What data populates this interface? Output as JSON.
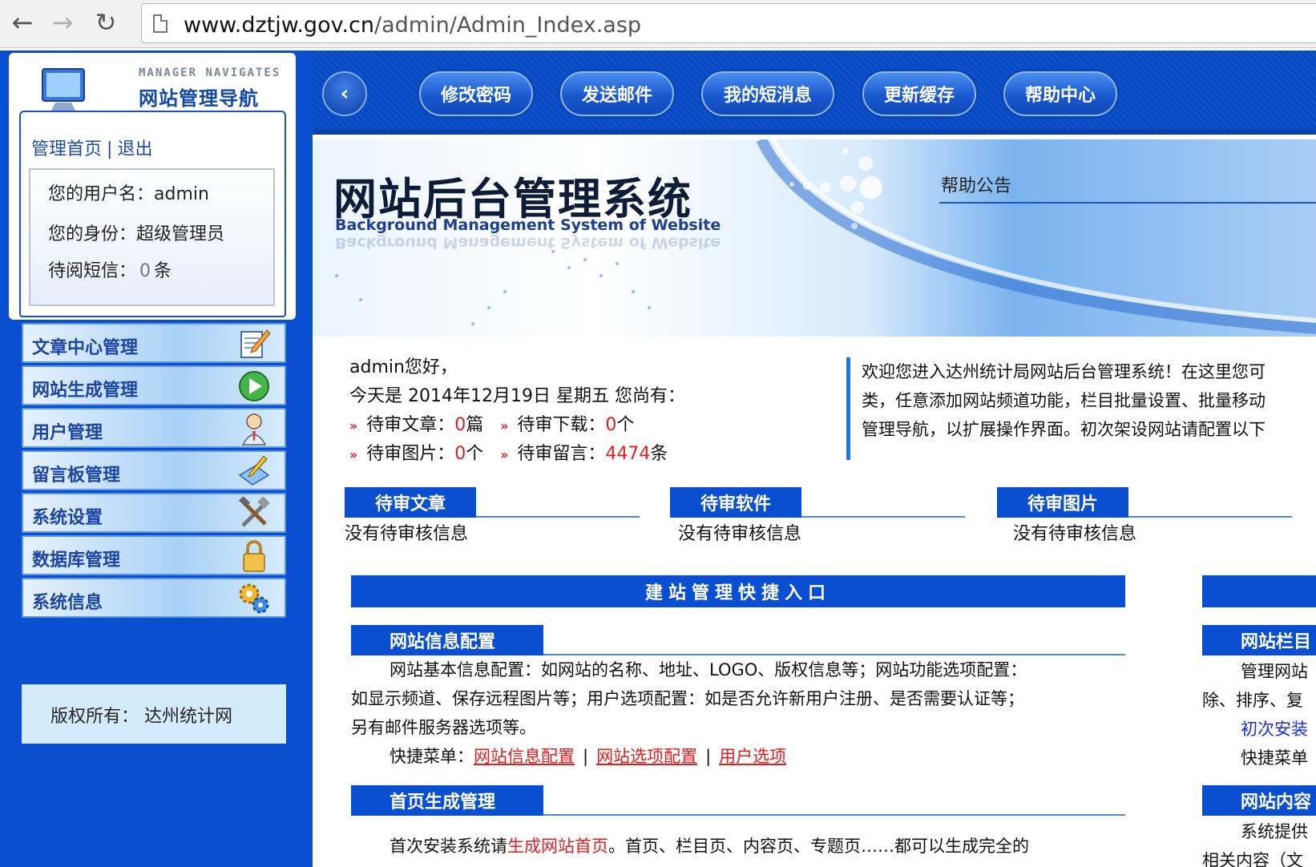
{
  "browser": {
    "url_host": "www.dztjw.gov.cn",
    "url_path": "/admin/Admin_Index.asp",
    "back_icon": "arrow-left-icon",
    "forward_icon": "arrow-right-icon",
    "reload_icon": "reload-icon"
  },
  "sidebar": {
    "logo_subtitle": "MANAGER NAVIGATES",
    "logo_title": "网站管理导航",
    "home_link": "管理首页",
    "link_separator": "|",
    "logout_link": "退出",
    "username_label": "您的用户名：",
    "username": "admin",
    "role_label": "您的身份：",
    "role": "超级管理员",
    "unread_label": "待阅短信：",
    "unread_count": "0",
    "unread_unit": "条",
    "menu": [
      {
        "label": "文章中心管理",
        "icon": "edit-document-icon"
      },
      {
        "label": "网站生成管理",
        "icon": "play-circle-icon"
      },
      {
        "label": "用户管理",
        "icon": "user-icon"
      },
      {
        "label": "留言板管理",
        "icon": "message-pencil-icon"
      },
      {
        "label": "系统设置",
        "icon": "tools-icon"
      },
      {
        "label": "数据库管理",
        "icon": "lock-icon"
      },
      {
        "label": "系统信息",
        "icon": "gears-icon"
      }
    ],
    "copyright": "版权所有： 达州统计网"
  },
  "toolbar": {
    "collapse_glyph": "‹",
    "buttons": [
      "修改密码",
      "发送邮件",
      "我的短消息",
      "更新缓存",
      "帮助中心"
    ]
  },
  "banner": {
    "title": "网站后台管理系统",
    "subtitle": "Background Management System of Website",
    "help_title": "帮助公告"
  },
  "greeting": {
    "line1": "admin您好，",
    "line2": "今天是 2014年12月19日 星期五 您尚有：",
    "arrow": "››",
    "pending_articles_label": "待审文章：",
    "pending_articles": "0",
    "pending_articles_unit": "篇",
    "pending_downloads_label": "待审下载：",
    "pending_downloads": "0",
    "pending_downloads_unit": "个",
    "pending_images_label": "待审图片：",
    "pending_images": "0",
    "pending_images_unit": "个",
    "pending_messages_label": "待审留言：",
    "pending_messages": "4474",
    "pending_messages_unit": "条"
  },
  "welcome": {
    "line1": "欢迎您进入达州统计局网站后台管理系统！在这里您可",
    "line2": "类，任意添加网站频道功能，栏目批量设置、批量移动",
    "line3": "管理导航，以扩展操作界面。初次架设网站请配置以下"
  },
  "pending_panels": [
    {
      "title": "待审文章",
      "empty": "没有待审核信息"
    },
    {
      "title": "待审软件",
      "empty": "没有待审核信息"
    },
    {
      "title": "待审图片",
      "empty": "没有待审核信息"
    }
  ],
  "quick_entry_title": "建站管理快捷入口",
  "site_config": {
    "title": "网站信息配置",
    "text1": "网站基本信息配置：如网站的名称、地址、LOGO、版权信息等；网站功能选项配置：",
    "text2": "如显示频道、保存远程图片等；用户选项配置：如是否允许新用户注册、是否需要认证等；",
    "text3": "另有邮件服务器选项等。",
    "shortcut_label": "快捷菜单：",
    "links": [
      "网站信息配置",
      "网站选项配置",
      "用户选项"
    ]
  },
  "homepage_gen": {
    "title": "首页生成管理",
    "text_prefix": "首次安装系统请",
    "text_link": "生成网站首页",
    "text_suffix": "。首页、栏目页、内容页、专题页……都可以生成完全的"
  },
  "right_column": {
    "section1_title": "网站栏目",
    "line1": "管理网站",
    "line2": "除、排序、复",
    "line3": "初次安装",
    "line4": "快捷菜单",
    "section2_title": "网站内容",
    "line5": "系统提供",
    "line6": "相关内容（文"
  }
}
